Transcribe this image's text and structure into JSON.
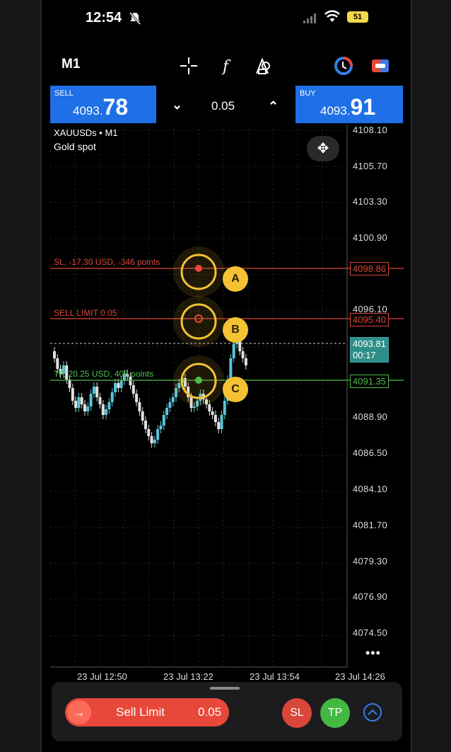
{
  "status_bar": {
    "time": "12:54",
    "battery": "51"
  },
  "toolbar": {
    "timeframe": "M1"
  },
  "trade_panel": {
    "sell": {
      "label": "SELL",
      "price_prefix": "4093.",
      "price_suffix": "78"
    },
    "buy": {
      "label": "BUY",
      "price_prefix": "4093.",
      "price_suffix": "91"
    },
    "volume": "0.05"
  },
  "chart": {
    "symbol": "XAUUSDs • M1",
    "description": "Gold spot",
    "y_axis_labels": [
      "4108.10",
      "4105.70",
      "4103.30",
      "4100.90",
      "4096.10",
      "4088.90",
      "4086.50",
      "4084.10",
      "4081.70",
      "4079.30",
      "4076.90",
      "4074.50"
    ],
    "x_axis_labels": [
      "23 Jul 12:50",
      "23 Jul 13:22",
      "23 Jul 13:54",
      "23 Jul 14:26"
    ],
    "sl_line": {
      "label": "SL, -17.30 USD, -346 points",
      "price": "4098.86",
      "color": "#d9463a"
    },
    "sell_limit_line": {
      "label": "SELL LIMIT 0.05",
      "price": "4095.40",
      "color": "#d9463a"
    },
    "current_price": {
      "price": "4093.81",
      "countdown": "00:17",
      "color": "#39a7a0"
    },
    "tp_line": {
      "label": "TP, 20.25 USD, 405 points",
      "price": "4091.35",
      "color": "#4fbf4a"
    },
    "markers": [
      "A",
      "B",
      "C"
    ]
  },
  "bottom_bar": {
    "order_button": "Sell Limit",
    "order_volume": "0.05",
    "sl_button": "SL",
    "tp_button": "TP"
  }
}
